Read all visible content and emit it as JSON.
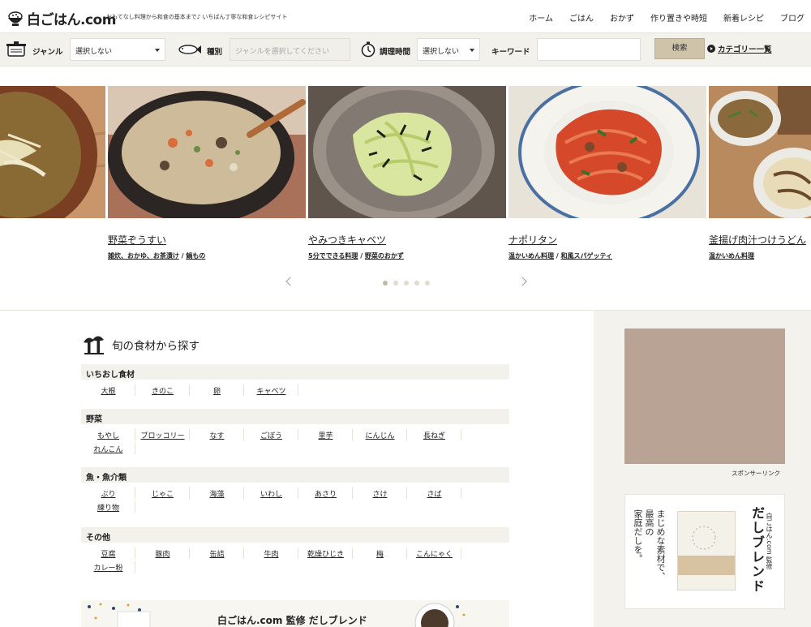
{
  "header": {
    "logo_text": "白ごはん.com",
    "tagline": "おもてなし料理から和食の基本まで♪ いちばん丁寧な和食レシピサイト",
    "nav": [
      "ホーム",
      "ごはん",
      "おかず",
      "作り置きや時短",
      "新着レシピ",
      "ブログ"
    ]
  },
  "search": {
    "genre_label": "ジャンル",
    "genre_value": "選択しない",
    "type_label": "種別",
    "type_placeholder": "ジャンルを選択してください",
    "time_label": "調理時間",
    "time_value": "選択しない",
    "keyword_label": "キーワード",
    "keyword_value": "",
    "button": "検索",
    "category_link": "カテゴリー一覧"
  },
  "carousel": {
    "slides": [
      {
        "title": "",
        "tags": []
      },
      {
        "title": "野菜ぞうすい",
        "tags": [
          "雑炊、おかゆ、お茶漬け",
          "鍋もの"
        ]
      },
      {
        "title": "やみつきキャベツ",
        "tags": [
          "5分でできる料理",
          "野菜のおかず"
        ]
      },
      {
        "title": "ナポリタン",
        "tags": [
          "温かいめん料理",
          "和風スパゲッティ"
        ]
      },
      {
        "title": "釜揚げ肉汁つけうどん",
        "tags": [
          "温かいめん料理"
        ]
      }
    ],
    "dots_total": 5,
    "active_dot": 1
  },
  "seasonal": {
    "title": "旬の食材から探す",
    "categories": [
      {
        "name": "いちおし食材",
        "items": [
          "大根",
          "きのこ",
          "卵",
          "キャベツ"
        ]
      },
      {
        "name": "野菜",
        "items": [
          "もやし",
          "ブロッコリー",
          "なす",
          "ごぼう",
          "里芋",
          "にんじん",
          "長ねぎ",
          "れんこん"
        ]
      },
      {
        "name": "魚・魚介類",
        "items": [
          "ぶり",
          "じゃこ",
          "海藻",
          "いわし",
          "あさり",
          "さけ",
          "さば",
          "練り物"
        ]
      },
      {
        "name": "その他",
        "items": [
          "豆腐",
          "豚肉",
          "缶詰",
          "牛肉",
          "乾燥ひじき",
          "梅",
          "こんにゃく",
          "カレー粉"
        ]
      }
    ]
  },
  "sidebar": {
    "sponsor_label": "スポンサーリンク",
    "book_title": "だしブレンド",
    "book_sub": "白ごはん.com 監修",
    "book_copy": [
      "まじめな素材で、",
      "最高の",
      "家庭だしを。"
    ]
  },
  "banner": {
    "text": "白ごはん.com 監修 だしブレンド"
  },
  "colors": {
    "search_bg": "#f2f1ec",
    "button": "#cfc3aa",
    "ad_placeholder": "#b8a395"
  }
}
